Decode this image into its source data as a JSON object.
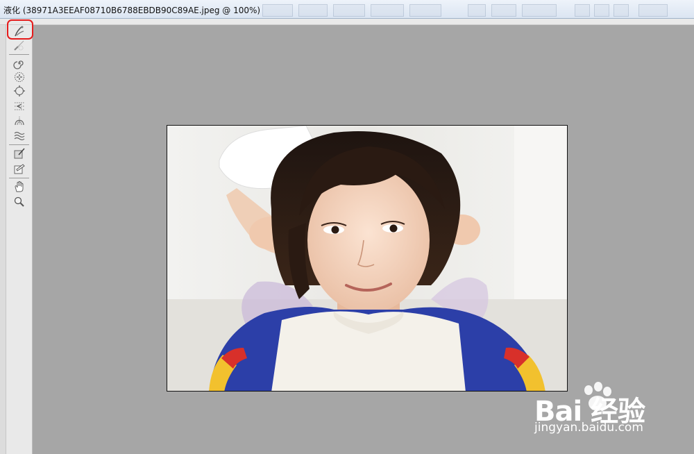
{
  "window": {
    "title": "液化 (38971A3EEAF08710B6788EBDB90C89AE.jpeg @ 100%)"
  },
  "toolbox": {
    "tools": [
      {
        "name": "forward-warp-tool",
        "icon": "warp-finger-icon"
      },
      {
        "name": "reconstruct-tool",
        "icon": "brush-icon"
      },
      {
        "name": "twirl-clockwise-tool",
        "icon": "swirl-icon"
      },
      {
        "name": "pucker-tool",
        "icon": "pucker-icon"
      },
      {
        "name": "bloat-tool",
        "icon": "bloat-icon"
      },
      {
        "name": "push-left-tool",
        "icon": "push-left-icon"
      },
      {
        "name": "mirror-tool",
        "icon": "mirror-icon"
      },
      {
        "name": "turbulence-tool",
        "icon": "turbulence-icon"
      },
      {
        "name": "freeze-mask-tool",
        "icon": "freeze-mask-icon"
      },
      {
        "name": "thaw-mask-tool",
        "icon": "thaw-mask-icon"
      },
      {
        "name": "hand-tool",
        "icon": "hand-icon"
      },
      {
        "name": "zoom-tool",
        "icon": "magnifier-icon"
      }
    ],
    "highlight_color": "#e51b1b"
  },
  "canvas": {
    "image_subject": "smiling woman with short dark hair in white and blue sweater",
    "background_color": "#a6a6a6"
  },
  "watermark": {
    "brand": "Bai 经验",
    "url": "jingyan.baidu.com"
  }
}
